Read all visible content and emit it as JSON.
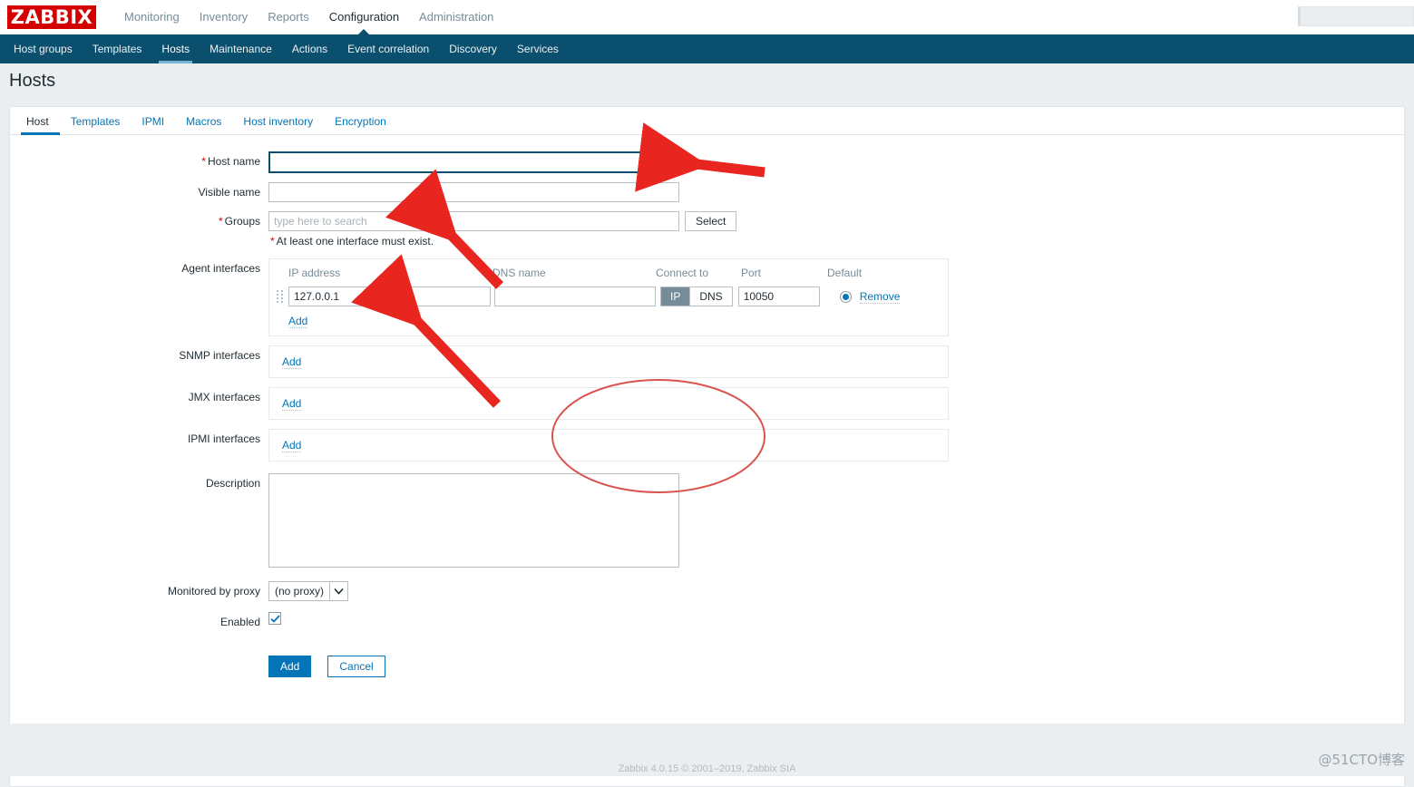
{
  "app": {
    "logo_text": "ZABBIX",
    "accent_blue": "#0275b8",
    "nav_dark": "#0b4f6e",
    "logo_red": "#d40000"
  },
  "topnav": {
    "items": [
      {
        "label": "Monitoring",
        "active": false
      },
      {
        "label": "Inventory",
        "active": false
      },
      {
        "label": "Reports",
        "active": false
      },
      {
        "label": "Configuration",
        "active": true
      },
      {
        "label": "Administration",
        "active": false
      }
    ],
    "search": {
      "value": "",
      "placeholder": ""
    }
  },
  "subnav": {
    "items": [
      {
        "label": "Host groups",
        "active": false
      },
      {
        "label": "Templates",
        "active": false
      },
      {
        "label": "Hosts",
        "active": true
      },
      {
        "label": "Maintenance",
        "active": false
      },
      {
        "label": "Actions",
        "active": false
      },
      {
        "label": "Event correlation",
        "active": false
      },
      {
        "label": "Discovery",
        "active": false
      },
      {
        "label": "Services",
        "active": false
      }
    ]
  },
  "page": {
    "title": "Hosts"
  },
  "form_tabs": [
    {
      "label": "Host",
      "active": true
    },
    {
      "label": "Templates",
      "active": false
    },
    {
      "label": "IPMI",
      "active": false
    },
    {
      "label": "Macros",
      "active": false
    },
    {
      "label": "Host inventory",
      "active": false
    },
    {
      "label": "Encryption",
      "active": false
    }
  ],
  "form": {
    "host_name": {
      "label": "Host name",
      "required": true,
      "value": "",
      "placeholder": "",
      "focused": true
    },
    "visible_name": {
      "label": "Visible name",
      "required": false,
      "value": "",
      "placeholder": ""
    },
    "groups": {
      "label": "Groups",
      "required": true,
      "value": "",
      "placeholder": "type here to search",
      "select_button": "Select"
    },
    "interface_note": {
      "marker": "*",
      "text": "At least one interface must exist."
    },
    "agent_interfaces": {
      "label": "Agent interfaces",
      "columns": {
        "ip": "IP address",
        "dns": "DNS name",
        "connect_to": "Connect to",
        "port": "Port",
        "default": "Default"
      },
      "rows": [
        {
          "ip": "127.0.0.1",
          "dns": "",
          "connect_to": "IP",
          "connect_options": [
            "IP",
            "DNS"
          ],
          "port": "10050",
          "is_default": true,
          "remove_label": "Remove"
        }
      ],
      "add_label": "Add"
    },
    "snmp_interfaces": {
      "label": "SNMP interfaces",
      "add_label": "Add"
    },
    "jmx_interfaces": {
      "label": "JMX interfaces",
      "add_label": "Add"
    },
    "ipmi_interfaces": {
      "label": "IPMI interfaces",
      "add_label": "Add"
    },
    "description": {
      "label": "Description",
      "value": "",
      "placeholder": ""
    },
    "monitored_by_proxy": {
      "label": "Monitored by proxy",
      "value": "(no proxy)",
      "options": [
        "(no proxy)"
      ]
    },
    "enabled": {
      "label": "Enabled",
      "checked": true
    },
    "actions": {
      "submit_label": "Add",
      "cancel_label": "Cancel"
    }
  },
  "footer": {
    "text": "Zabbix 4.0.15 © 2001–2019, Zabbix SIA",
    "watermark": "@51CTO博客"
  },
  "annotations": {
    "arrow_color": "#e8251f",
    "ellipse_color": "#d9534f",
    "arrows": [
      {
        "name": "arrow-to-host-name"
      },
      {
        "name": "arrow-to-groups"
      },
      {
        "name": "arrow-to-ip-address"
      }
    ],
    "ellipses": [
      {
        "name": "ellipse-interfaces-area"
      }
    ]
  }
}
